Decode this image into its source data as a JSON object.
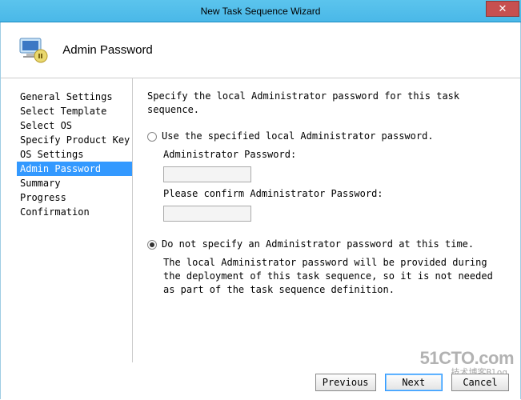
{
  "title": "New Task Sequence Wizard",
  "close": "✕",
  "header": {
    "title": "Admin Password"
  },
  "sidebar": {
    "items": [
      {
        "label": "General Settings"
      },
      {
        "label": "Select Template"
      },
      {
        "label": "Select OS"
      },
      {
        "label": "Specify Product Key"
      },
      {
        "label": "OS Settings"
      },
      {
        "label": "Admin Password"
      },
      {
        "label": "Summary"
      },
      {
        "label": "Progress"
      },
      {
        "label": "Confirmation"
      }
    ],
    "selected_index": 5
  },
  "main": {
    "instruction": "Specify the local Administrator password for this task sequence.",
    "option1": {
      "label": "Use the specified local Administrator password.",
      "selected": false,
      "pw_label": "Administrator Password:",
      "pw_value": "",
      "confirm_label": "Please confirm Administrator Password:",
      "confirm_value": ""
    },
    "option2": {
      "label": "Do not specify an Administrator password at this time.",
      "selected": true,
      "description": "The local Administrator password will be provided during the deployment of this task sequence, so it is not needed as part of the task sequence definition."
    }
  },
  "buttons": {
    "previous": "Previous",
    "next": "Next",
    "cancel": "Cancel"
  },
  "watermark": {
    "main": "51CTO.com",
    "sub": "技术博客Blog"
  }
}
